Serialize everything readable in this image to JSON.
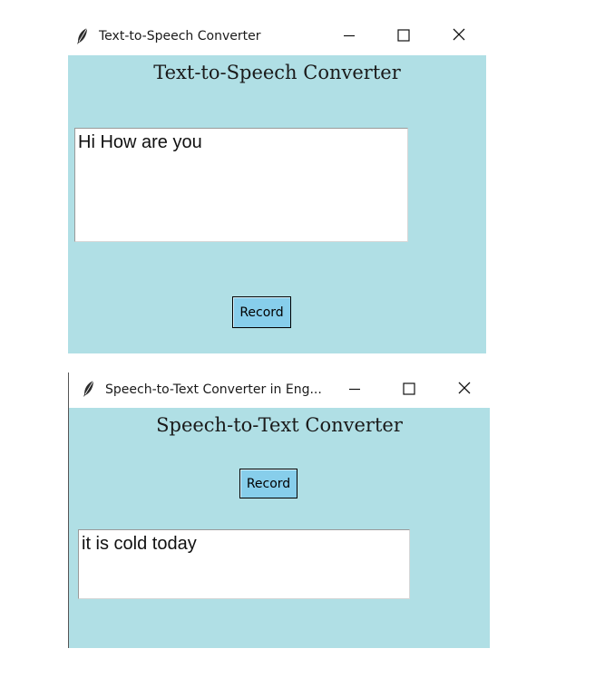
{
  "window1": {
    "title": "Text-to-Speech Converter",
    "heading": "Text-to-Speech Converter",
    "textbox_value": "Hi How are you",
    "record_label": "Record",
    "bg_color": "#b0dfe5",
    "button_color": "#87ceeb"
  },
  "window2": {
    "title": "Speech-to-Text Converter in Eng...",
    "heading": "Speech-to-Text Converter",
    "record_label": "Record",
    "textbox_value": "it is cold today",
    "bg_color": "#b0dfe5",
    "button_color": "#87ceeb"
  },
  "icons": {
    "app": "feather-icon",
    "minimize": "minimize-icon",
    "maximize": "maximize-icon",
    "close": "close-icon"
  }
}
